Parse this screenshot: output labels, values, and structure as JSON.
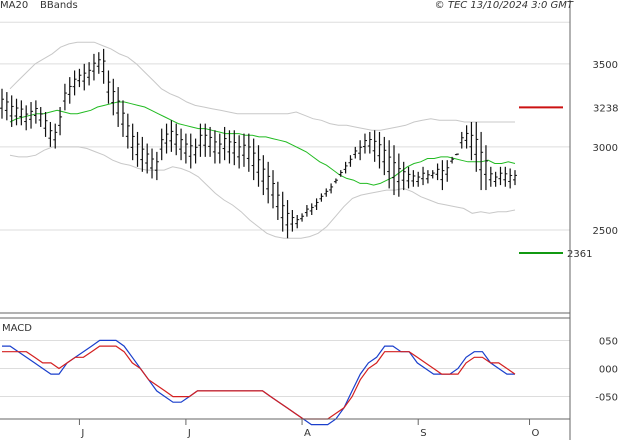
{
  "copyright": "© TEC 13/10/2024 3:0 GMT",
  "legend": {
    "ma20_label": "MA20",
    "bbands_label": "BBands"
  },
  "colors": {
    "ma20": "#22bb22",
    "bbands": "#c8c8c8",
    "price": "#111111",
    "macd": "#1a3fcc",
    "signal": "#d42020",
    "resistance": "#cc1111",
    "support": "#119911",
    "grid": "#dddddd",
    "axis": "#666666"
  },
  "chart_data": [
    {
      "type": "ohlc",
      "title": "",
      "ylim": [
        2000,
        3800
      ],
      "y_ticks": [
        {
          "label": "3500",
          "value": 3500
        },
        {
          "label": "3000",
          "value": 3000
        },
        {
          "label": "2500",
          "value": 2500
        }
      ],
      "x_ticks": [
        {
          "label": "J",
          "index": 16
        },
        {
          "label": "J",
          "index": 38
        },
        {
          "label": "A",
          "index": 62
        },
        {
          "label": "S",
          "index": 86
        },
        {
          "label": "O",
          "index": 109
        }
      ],
      "legend": [
        "MA20",
        "BBands"
      ],
      "levels": [
        {
          "name": "resistance",
          "label": "3238",
          "value": 3238
        },
        {
          "name": "support",
          "label": "2361",
          "value": 2361
        }
      ],
      "price_high": [
        3350,
        3330,
        3310,
        3290,
        3280,
        3250,
        3270,
        3280,
        3240,
        3210,
        3150,
        3140,
        3240,
        3380,
        3420,
        3460,
        3470,
        3500,
        3510,
        3560,
        3570,
        3590,
        3460,
        3410,
        3360,
        3280,
        3200,
        3140,
        3090,
        3060,
        3020,
        2990,
        2970,
        3110,
        3140,
        3160,
        3140,
        3110,
        3080,
        3080,
        3050,
        3140,
        3140,
        3120,
        3100,
        3080,
        3120,
        3100,
        3100,
        3070,
        3080,
        3080,
        3050,
        3010,
        2950,
        2910,
        2860,
        2790,
        2730,
        2680,
        2620,
        2590,
        2600,
        2650,
        2660,
        2690,
        2720,
        2750,
        2780,
        2810,
        2860,
        2910,
        2950,
        3000,
        3040,
        3080,
        3090,
        3100,
        3090,
        3060,
        3040,
        3010,
        2960,
        2910,
        2880,
        2860,
        2850,
        2880,
        2860,
        2860,
        2900,
        2920,
        2920,
        2940,
        2960,
        3090,
        3130,
        3150,
        3150,
        3090,
        3010,
        2880,
        2850,
        2880,
        2880,
        2870,
        2860
      ],
      "price_low": [
        3170,
        3160,
        3120,
        3130,
        3130,
        3100,
        3110,
        3140,
        3120,
        3060,
        3000,
        2990,
        3070,
        3220,
        3260,
        3310,
        3360,
        3340,
        3370,
        3400,
        3440,
        3380,
        3260,
        3190,
        3120,
        3060,
        2990,
        2920,
        2880,
        2850,
        2840,
        2810,
        2800,
        2920,
        2960,
        2970,
        2950,
        2920,
        2900,
        2870,
        2900,
        2940,
        2940,
        2940,
        2900,
        2900,
        2920,
        2900,
        2890,
        2870,
        2880,
        2850,
        2800,
        2760,
        2710,
        2660,
        2630,
        2560,
        2490,
        2450,
        2490,
        2510,
        2550,
        2580,
        2590,
        2620,
        2670,
        2700,
        2720,
        2780,
        2820,
        2840,
        2880,
        2930,
        2920,
        2960,
        2960,
        2910,
        2870,
        2830,
        2750,
        2710,
        2700,
        2740,
        2750,
        2760,
        2760,
        2770,
        2780,
        2810,
        2800,
        2740,
        2790,
        2900,
        2950,
        2990,
        2990,
        2920,
        2850,
        2740,
        2740,
        2760,
        2760,
        2770,
        2760,
        2750,
        2770
      ],
      "ma20": [
        3150,
        3170,
        3180,
        3190,
        3200,
        3200,
        3210,
        3220,
        3210,
        3200,
        3200,
        3210,
        3220,
        3240,
        3250,
        3260,
        3270,
        3270,
        3260,
        3250,
        3240,
        3220,
        3200,
        3180,
        3160,
        3140,
        3130,
        3120,
        3110,
        3110,
        3100,
        3090,
        3080,
        3080,
        3080,
        3070,
        3070,
        3060,
        3060,
        3050,
        3040,
        3030,
        3010,
        2990,
        2970,
        2940,
        2910,
        2890,
        2860,
        2830,
        2810,
        2800,
        2780,
        2780,
        2770,
        2780,
        2800,
        2820,
        2850,
        2880,
        2900,
        2910,
        2930,
        2930,
        2940,
        2940,
        2930,
        2920,
        2910,
        2910,
        2910,
        2920,
        2900,
        2900,
        2910,
        2900
      ],
      "bb_upper": [
        3350,
        3400,
        3450,
        3500,
        3530,
        3560,
        3600,
        3620,
        3630,
        3630,
        3630,
        3610,
        3590,
        3560,
        3540,
        3500,
        3450,
        3400,
        3350,
        3320,
        3300,
        3270,
        3250,
        3240,
        3230,
        3220,
        3210,
        3200,
        3200,
        3200,
        3200,
        3200,
        3200,
        3200,
        3210,
        3190,
        3170,
        3160,
        3140,
        3130,
        3130,
        3120,
        3110,
        3100,
        3100,
        3110,
        3120,
        3130,
        3150,
        3160,
        3170,
        3160,
        3160,
        3160,
        3150,
        3150,
        3150,
        3150,
        3150,
        3150,
        3150
      ],
      "bb_lower": [
        2950,
        2940,
        2940,
        2950,
        2980,
        3000,
        3000,
        3000,
        3000,
        2990,
        2970,
        2950,
        2920,
        2900,
        2890,
        2870,
        2860,
        2860,
        2860,
        2880,
        2870,
        2850,
        2820,
        2770,
        2720,
        2680,
        2650,
        2610,
        2560,
        2520,
        2480,
        2460,
        2450,
        2450,
        2450,
        2460,
        2480,
        2520,
        2580,
        2640,
        2690,
        2710,
        2720,
        2730,
        2740,
        2740,
        2750,
        2730,
        2700,
        2680,
        2660,
        2650,
        2640,
        2630,
        2600,
        2610,
        2600,
        2610,
        2610,
        2620
      ]
    },
    {
      "type": "line",
      "title": "MACD",
      "ylim": [
        -0.09,
        0.09
      ],
      "y_ticks": [
        {
          "label": "050",
          "value": 0.05
        },
        {
          "label": "000",
          "value": 0
        },
        {
          "label": "-050",
          "value": -0.05
        }
      ],
      "series": [
        {
          "name": "macd",
          "values": [
            0.04,
            0.04,
            0.03,
            0.02,
            0.01,
            0,
            -0.01,
            -0.01,
            0.01,
            0.02,
            0.03,
            0.04,
            0.05,
            0.05,
            0.05,
            0.04,
            0.02,
            0,
            -0.02,
            -0.04,
            -0.05,
            -0.06,
            -0.06,
            -0.05,
            -0.04,
            -0.04,
            -0.04,
            -0.04,
            -0.04,
            -0.04,
            -0.04,
            -0.04,
            -0.04,
            -0.05,
            -0.06,
            -0.07,
            -0.08,
            -0.09,
            -0.1,
            -0.1,
            -0.1,
            -0.09,
            -0.07,
            -0.04,
            -0.01,
            0.01,
            0.02,
            0.04,
            0.04,
            0.03,
            0.03,
            0.01,
            0,
            -0.01,
            -0.01,
            -0.01,
            0,
            0.02,
            0.03,
            0.03,
            0.01,
            0,
            -0.01,
            -0.01
          ]
        },
        {
          "name": "signal",
          "values": [
            0.03,
            0.03,
            0.03,
            0.03,
            0.02,
            0.01,
            0.01,
            0,
            0.01,
            0.02,
            0.02,
            0.03,
            0.04,
            0.04,
            0.04,
            0.03,
            0.01,
            0,
            -0.02,
            -0.03,
            -0.04,
            -0.05,
            -0.05,
            -0.05,
            -0.04,
            -0.04,
            -0.04,
            -0.04,
            -0.04,
            -0.04,
            -0.04,
            -0.04,
            -0.04,
            -0.05,
            -0.06,
            -0.07,
            -0.08,
            -0.09,
            -0.09,
            -0.09,
            -0.09,
            -0.08,
            -0.07,
            -0.05,
            -0.02,
            0,
            0.01,
            0.03,
            0.03,
            0.03,
            0.03,
            0.02,
            0.01,
            0,
            -0.01,
            -0.01,
            -0.01,
            0.01,
            0.02,
            0.02,
            0.01,
            0.01,
            0,
            -0.01
          ]
        }
      ]
    }
  ]
}
